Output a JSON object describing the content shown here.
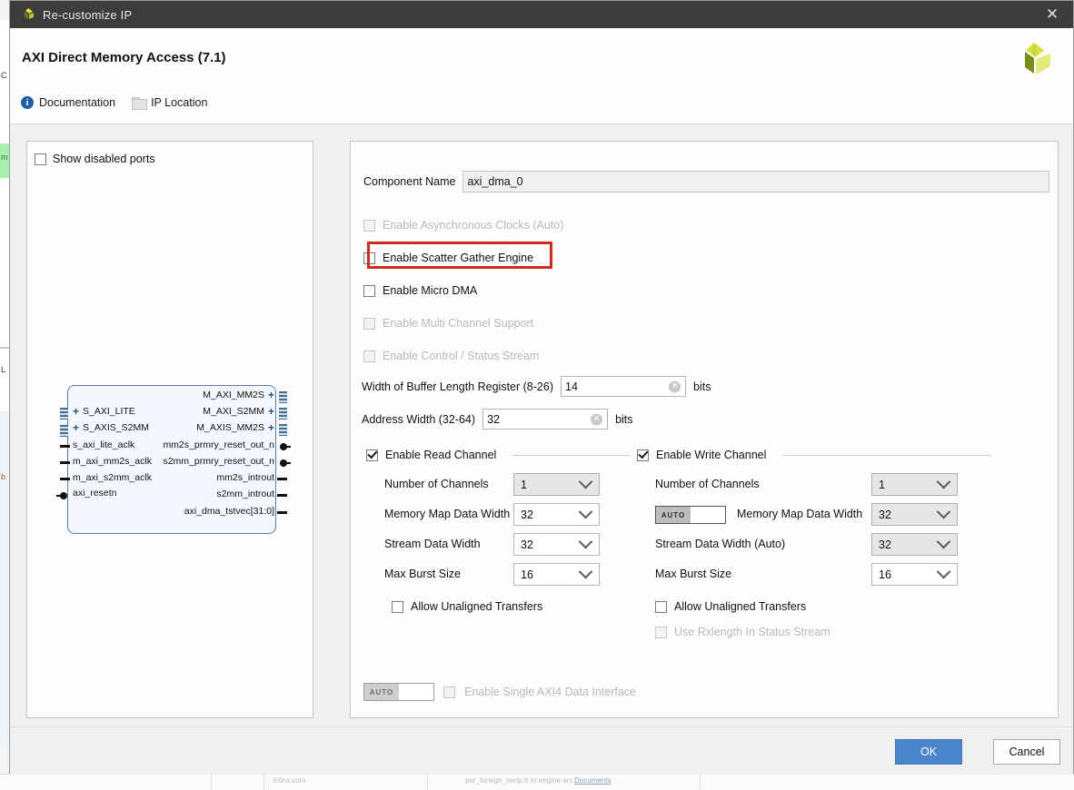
{
  "window": {
    "title": "Re-customize IP",
    "logo_icon": "xilinx-logo-icon",
    "close_icon": "close-icon"
  },
  "header": {
    "ip_title": "AXI Direct Memory Access (7.1)",
    "vendor_logo_icon": "xilinx-pinwheel-logo-icon",
    "links": [
      {
        "label": "Documentation",
        "icon": "info-icon"
      },
      {
        "label": "IP Location",
        "icon": "folder-icon"
      }
    ]
  },
  "left_panel": {
    "show_disabled_ports": {
      "label": "Show disabled ports",
      "checked": false
    },
    "block_diagram": {
      "left_ports": [
        {
          "name": "S_AXI_LITE",
          "type": "bus"
        },
        {
          "name": "S_AXIS_S2MM",
          "type": "bus"
        },
        {
          "name": "s_axi_lite_aclk",
          "type": "pin"
        },
        {
          "name": "m_axi_mm2s_aclk",
          "type": "pin"
        },
        {
          "name": "m_axi_s2mm_aclk",
          "type": "pin"
        },
        {
          "name": "axi_resetn",
          "type": "pin-circle"
        }
      ],
      "right_ports": [
        {
          "name": "M_AXI_MM2S",
          "type": "bus"
        },
        {
          "name": "M_AXI_S2MM",
          "type": "bus"
        },
        {
          "name": "M_AXIS_MM2S",
          "type": "bus"
        },
        {
          "name": "mm2s_prmry_reset_out_n",
          "type": "pin-circle"
        },
        {
          "name": "s2mm_prmry_reset_out_n",
          "type": "pin-circle"
        },
        {
          "name": "mm2s_introut",
          "type": "pin"
        },
        {
          "name": "s2mm_introut",
          "type": "pin"
        },
        {
          "name": "axi_dma_tstvec[31:0]",
          "type": "pin"
        }
      ]
    }
  },
  "main": {
    "component_name": {
      "label": "Component Name",
      "value": "axi_dma_0"
    },
    "options": [
      {
        "label": "Enable Asynchronous Clocks (Auto)",
        "checked": false,
        "disabled": true,
        "highlighted": false
      },
      {
        "label": "Enable Scatter Gather Engine",
        "checked": false,
        "disabled": false,
        "highlighted": true
      },
      {
        "label": "Enable Micro DMA",
        "checked": false,
        "disabled": false,
        "highlighted": false
      },
      {
        "label": "Enable Multi Channel Support",
        "checked": false,
        "disabled": true,
        "highlighted": false
      },
      {
        "label": "Enable Control / Status Stream",
        "checked": false,
        "disabled": true,
        "highlighted": false
      }
    ],
    "buffer_length_register": {
      "label": "Width of Buffer Length Register (8-26)",
      "value": "14",
      "unit": "bits",
      "clear_icon": "clear-icon"
    },
    "address_width": {
      "label": "Address Width (32-64)",
      "value": "32",
      "unit": "bits",
      "clear_icon": "clear-icon"
    },
    "read_channel": {
      "group_label": "Enable Read Channel",
      "checked": true,
      "fields": [
        {
          "label": "Number of Channels",
          "value": "1",
          "disabled": true
        },
        {
          "label": "Memory Map Data Width",
          "value": "32",
          "disabled": false
        },
        {
          "label": "Stream Data Width",
          "value": "32",
          "disabled": false
        },
        {
          "label": "Max Burst Size",
          "value": "16",
          "disabled": false
        }
      ],
      "allow_unaligned": {
        "label": "Allow Unaligned Transfers",
        "checked": false,
        "disabled": false
      }
    },
    "write_channel": {
      "group_label": "Enable Write Channel",
      "checked": true,
      "fields": [
        {
          "label": "Number of Channels",
          "value": "1",
          "disabled": true,
          "auto": false
        },
        {
          "label": "Memory Map Data Width",
          "value": "32",
          "disabled": true,
          "auto": true,
          "auto_label": "AUTO"
        },
        {
          "label": "Stream Data Width (Auto)",
          "value": "32",
          "disabled": true,
          "auto": false
        },
        {
          "label": "Max Burst Size",
          "value": "16",
          "disabled": false,
          "auto": false
        }
      ],
      "allow_unaligned": {
        "label": "Allow Unaligned Transfers",
        "checked": false,
        "disabled": false
      },
      "use_rxlength": {
        "label": "Use Rxlength In Status Stream",
        "checked": false,
        "disabled": true
      }
    },
    "single_axi4": {
      "auto_label": "AUTO",
      "label": "Enable Single AXI4 Data Interface",
      "checked": false,
      "disabled": true
    }
  },
  "footer": {
    "ok_label": "OK",
    "cancel_label": "Cancel"
  },
  "colors": {
    "accent_blue": "#4a86cb",
    "highlight_red": "#d32a20",
    "titlebar": "#3c3c3c",
    "logo_green": "#cfe03a"
  },
  "background": {
    "left_labels": [
      "C",
      "m",
      "L",
      "b"
    ],
    "bottom_items": [
      "Xilinx.com",
      "per_foreign_temp.tr to engine arc",
      "Documents"
    ]
  }
}
